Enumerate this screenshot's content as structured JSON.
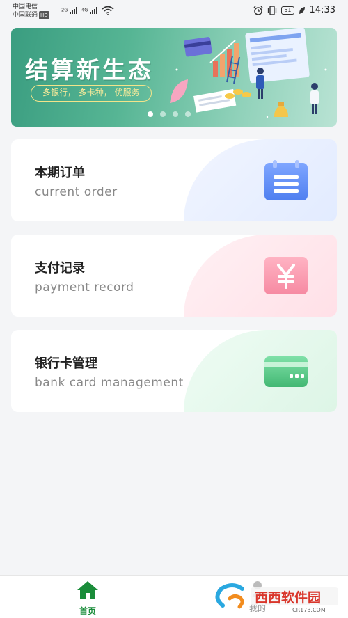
{
  "status_bar": {
    "carrier_1": "中国电信",
    "carrier_2": "中国联通",
    "hd_badge": "HD",
    "net_1": "2G",
    "net_2": "4G",
    "battery": "51",
    "time": "14:33"
  },
  "banner": {
    "title": "结算新生态",
    "tagline": "多银行， 多卡种， 优服务",
    "slide_count": 4,
    "active_slide": 1
  },
  "cards": [
    {
      "title": "本期订单",
      "subtitle": "current order",
      "icon": "calendar-list-icon",
      "color": "#5b8af5"
    },
    {
      "title": "支付记录",
      "subtitle": "payment record",
      "icon": "yuan-icon",
      "color": "#f28aa0"
    },
    {
      "title": "银行卡管理",
      "subtitle": "bank card management",
      "icon": "bank-card-icon",
      "color": "#4cc37f"
    }
  ],
  "nav": {
    "home_label": "首页",
    "mine_label": "我的"
  },
  "colors": {
    "accent": "#1a8c3a",
    "banner": "#4aaa88"
  },
  "watermark": {
    "name": "西西软件园",
    "url": "CR173.COM"
  }
}
